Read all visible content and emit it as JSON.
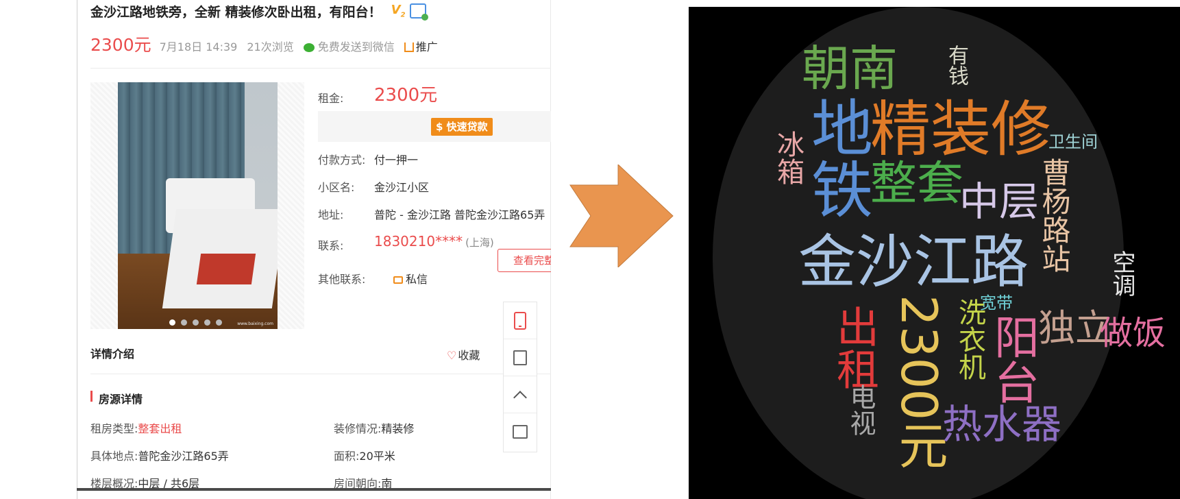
{
  "listing": {
    "title": "金沙江路地铁旁，全新 精装修次卧出租，有阳台！",
    "badge": "V",
    "badge_sub": "2",
    "price": "2300元",
    "date": "7月18日 14:39",
    "views": "21次浏览",
    "wechat": "免费发送到微信",
    "promote": "推广",
    "rent_label": "租金:",
    "rent_value": "2300元",
    "loan_button": "$ 快速贷款",
    "pay_label": "付款方式:",
    "pay_value": "付一押一",
    "community_label": "小区名:",
    "community_value": "金沙江小区",
    "address_label": "地址:",
    "address_value": "普陀 - 金沙江路 普陀金沙江路65弄",
    "contact_label": "联系:",
    "contact_phone": "1830210****",
    "contact_region": "(上海)",
    "full_number_button": "查看完整",
    "other_contact_label": "其他联系:",
    "private_message": "私信",
    "detail_heading": "详情介绍",
    "favorite": "收藏",
    "section_title": "房源详情",
    "attributes": [
      {
        "key": "租房类型:",
        "value": "整套出租",
        "highlight": true
      },
      {
        "key": "装修情况:",
        "value": "精装修",
        "highlight": false
      },
      {
        "key": "具体地点:",
        "value": "普陀金沙江路65弄",
        "highlight": false
      },
      {
        "key": "面积:",
        "value": "20平米",
        "highlight": false
      },
      {
        "key": "楼层概况:",
        "value": "中层 / 共6层",
        "highlight": false
      },
      {
        "key": "房间朝向:",
        "value": "南",
        "highlight": false
      }
    ],
    "photo_watermark": "www.baixing.com",
    "photo_count": 5,
    "photo_active_index": 0
  },
  "toolbar": {
    "icons": [
      "phone-icon",
      "edit-icon",
      "back-to-top-icon",
      "chat-icon"
    ]
  },
  "colors": {
    "accent_red": "#ea4c4c",
    "accent_orange": "#f08c1a",
    "arrow_fill": "#e9954f"
  },
  "wordcloud": {
    "words": [
      {
        "text": "朝南",
        "color": "#6aa84f"
      },
      {
        "text": "有钱",
        "color": "#d8d8c8"
      },
      {
        "text": "地铁",
        "color": "#5b8fd6"
      },
      {
        "text": "精装修",
        "color": "#e07b28"
      },
      {
        "text": "卫生间",
        "color": "#9fd3d6"
      },
      {
        "text": "冰箱",
        "color": "#e8a7a7"
      },
      {
        "text": "整套",
        "color": "#4cae4c"
      },
      {
        "text": "中层",
        "color": "#d6c8e8"
      },
      {
        "text": "曹杨路站",
        "color": "#e8c4a4"
      },
      {
        "text": "金沙江路",
        "color": "#a9c4e4"
      },
      {
        "text": "空调",
        "color": "#e8e8e8"
      },
      {
        "text": "宽带",
        "color": "#6fd0d6"
      },
      {
        "text": "出租",
        "color": "#e23b3b"
      },
      {
        "text": "2300元",
        "color": "#e6c45a"
      },
      {
        "text": "洗衣机",
        "color": "#c4d44a"
      },
      {
        "text": "阳台",
        "color": "#e46fa0"
      },
      {
        "text": "独立",
        "color": "#c4a090"
      },
      {
        "text": "做饭",
        "color": "#e46fa0"
      },
      {
        "text": "电视",
        "color": "#a8a8a8"
      },
      {
        "text": "热水器",
        "color": "#8e6fc4"
      }
    ]
  }
}
